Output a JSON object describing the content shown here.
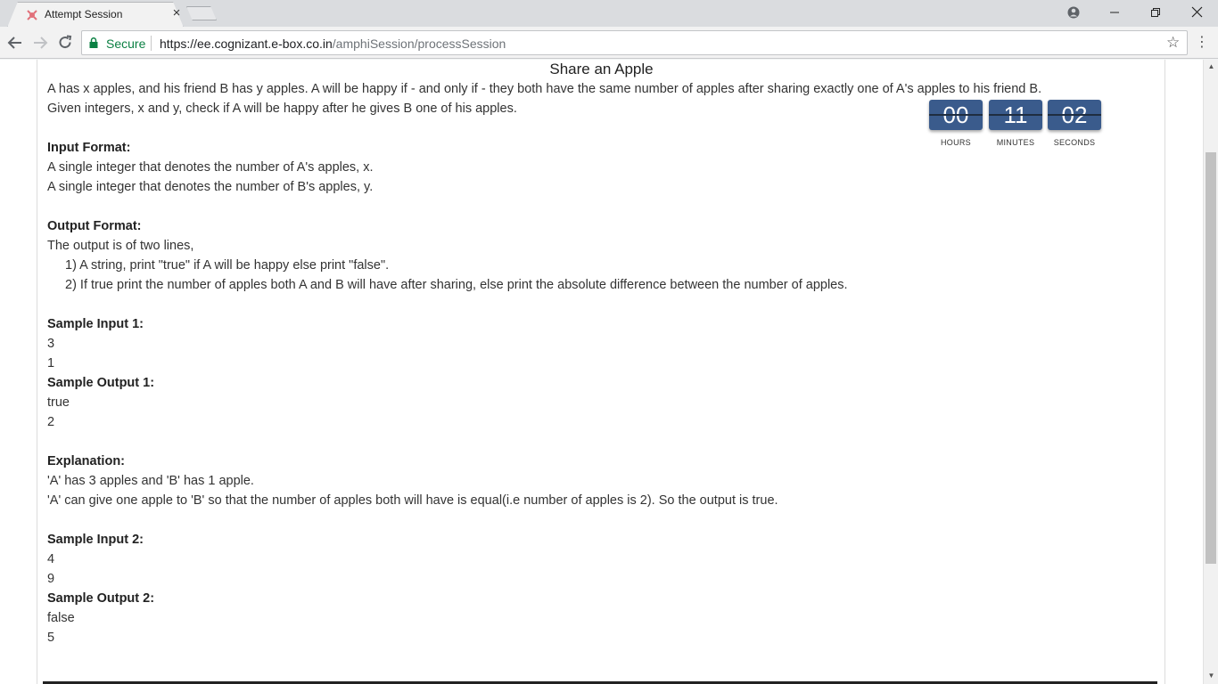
{
  "browser": {
    "tab_title": "Attempt Session",
    "tab_close": "×",
    "secure_label": "Secure",
    "url_host": "https://ee.cognizant.e-box.co.in",
    "url_path": "/amphiSession/processSession",
    "accent_secure": "#0b8043"
  },
  "problem": {
    "title": "Share an Apple",
    "statement_1": "A has x apples, and his friend B has y apples. A will be happy if - and only if - they both have the same number of apples after sharing exactly one of A's apples to his friend B.",
    "statement_2": "Given integers, x and y, check if A will be happy after he gives B one of his apples.",
    "input_format_heading": "Input Format:",
    "input_format_1": "A single integer that denotes the number of A's apples, x.",
    "input_format_2": "A single integer that denotes the number of B's apples, y.",
    "output_format_heading": "Output Format:",
    "output_format_1": "The output is of two lines,",
    "output_format_2": "1) A string, print \"true\" if A will be happy else print \"false\".",
    "output_format_3": "2) If true print the number of apples both A and B will have after sharing, else print the absolute difference between the number of apples.",
    "sample_input_1_heading": "Sample Input 1:",
    "sample_input_1": [
      "3",
      "1"
    ],
    "sample_output_1_heading": "Sample Output 1:",
    "sample_output_1": [
      "true",
      "2"
    ],
    "explanation_heading": "Explanation:",
    "explanation_1": "'A' has 3 apples and 'B' has 1 apple.",
    "explanation_2": "'A' can give one apple to 'B' so that the number of apples both will have is equal(i.e number of apples is 2). So the output is true.",
    "sample_input_2_heading": "Sample Input 2:",
    "sample_input_2": [
      "4",
      "9"
    ],
    "sample_output_2_heading": "Sample Output 2:",
    "sample_output_2": [
      "false",
      "5"
    ]
  },
  "timer": {
    "hours": "00",
    "minutes": "11",
    "seconds": "02",
    "hours_label": "HOURS",
    "minutes_label": "MINUTES",
    "seconds_label": "SECONDS",
    "box_color": "#3a5b8c"
  }
}
